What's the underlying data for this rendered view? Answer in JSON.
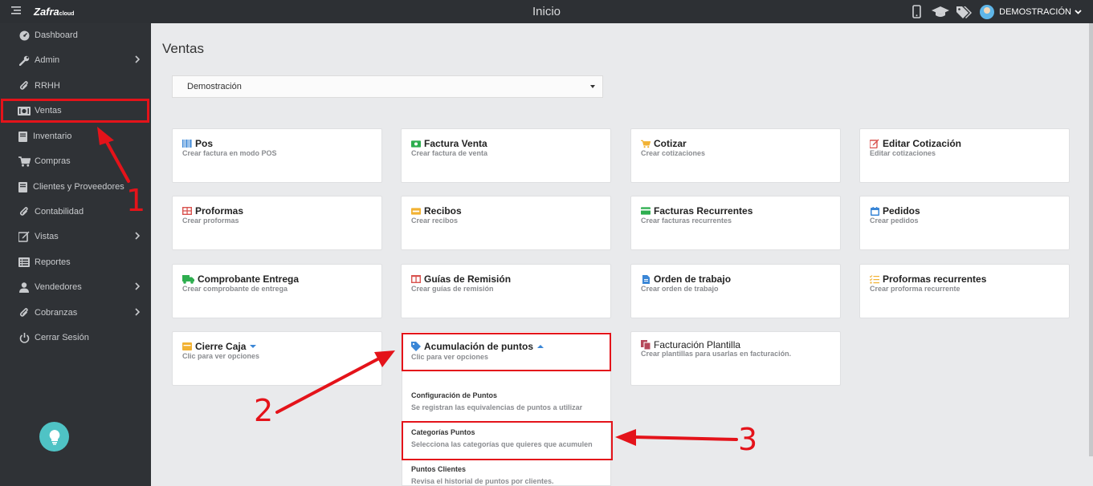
{
  "topbar": {
    "title": "Inicio",
    "logo": "Zafra",
    "logo_suffix": "cloud",
    "user_name": "DEMOSTRACIÓN",
    "icons": [
      "menu-icon",
      "mobile-icon",
      "graduation-cap-icon",
      "tags-icon",
      "avatar",
      "chevron-down-icon"
    ]
  },
  "sidebar": {
    "items": [
      {
        "label": "Dashboard",
        "icon": "dashboard-icon",
        "chevron": false
      },
      {
        "label": "Admin",
        "icon": "wrench-icon",
        "chevron": true
      },
      {
        "label": "RRHH",
        "icon": "paperclip-icon",
        "chevron": false
      },
      {
        "label": "Ventas",
        "icon": "money-icon",
        "chevron": false,
        "active": true
      },
      {
        "label": "Inventario",
        "icon": "book-icon",
        "chevron": false
      },
      {
        "label": "Compras",
        "icon": "cart-icon",
        "chevron": false
      },
      {
        "label": "Clientes y Proveedores",
        "icon": "address-book-icon",
        "chevron": false
      },
      {
        "label": "Contabilidad",
        "icon": "paperclip-icon",
        "chevron": false
      },
      {
        "label": "Vistas",
        "icon": "edit-icon",
        "chevron": true
      },
      {
        "label": "Reportes",
        "icon": "list-icon",
        "chevron": false
      },
      {
        "label": "Vendedores",
        "icon": "user-icon",
        "chevron": true
      },
      {
        "label": "Cobranzas",
        "icon": "paperclip-icon",
        "chevron": true
      },
      {
        "label": "Cerrar Sesión",
        "icon": "power-icon",
        "chevron": false
      }
    ]
  },
  "main": {
    "page_title": "Ventas",
    "company_select": "Demostración",
    "cards": [
      {
        "title": "Pos",
        "subtitle": "Crear factura en modo POS",
        "icon": "barcode-icon",
        "color": "#3a86d6"
      },
      {
        "title": "Factura Venta",
        "subtitle": "Crear factura de venta",
        "icon": "money-icon",
        "color": "#2eae4f"
      },
      {
        "title": "Cotizar",
        "subtitle": "Crear cotizaciones",
        "icon": "cart-icon",
        "color": "#f2b233"
      },
      {
        "title": "Editar Cotización",
        "subtitle": "Editar cotizaciones",
        "icon": "edit-icon",
        "color": "#d9534f"
      },
      {
        "title": "Proformas",
        "subtitle": "Crear proformas",
        "icon": "table-icon",
        "color": "#d9534f"
      },
      {
        "title": "Recibos",
        "subtitle": "Crear recibos",
        "icon": "receipt-icon",
        "color": "#f2b233"
      },
      {
        "title": "Facturas Recurrentes",
        "subtitle": "Crear facturas recurrentes",
        "icon": "credit-card-icon",
        "color": "#2eae4f"
      },
      {
        "title": "Pedidos",
        "subtitle": "Crear pedidos",
        "icon": "calendar-icon",
        "color": "#3a86d6"
      },
      {
        "title": "Comprobante Entrega",
        "subtitle": "Crear comprobante de entrega",
        "icon": "truck-icon",
        "color": "#2eae4f"
      },
      {
        "title": "Guías de Remisión",
        "subtitle": "Crear guías de remisión",
        "icon": "columns-icon",
        "color": "#d9534f"
      },
      {
        "title": "Orden de trabajo",
        "subtitle": "Crear orden de trabajo",
        "icon": "file-icon",
        "color": "#3a86d6"
      },
      {
        "title": "Proformas recurrentes",
        "subtitle": "Crear proforma recurrente",
        "icon": "tasks-icon",
        "color": "#f2b233"
      },
      {
        "title": "Cierre Caja",
        "subtitle": "Clic para ver opciones",
        "icon": "cash-box-icon",
        "color": "#f2b233",
        "caret": "down"
      },
      {
        "title": "Acumulación de puntos",
        "subtitle": "Clic para ver opciones",
        "icon": "tag-icon",
        "color": "#3a86d6",
        "caret": "up"
      },
      {
        "title": "Facturación Plantilla",
        "subtitle": "Crear plantillas para usarlas en facturación.",
        "icon": "copy-icon",
        "color": "#b5485a"
      }
    ],
    "dropdown": [
      {
        "title": "Configuración de Puntos",
        "subtitle": "Se registran las equivalencias de puntos a utilizar"
      },
      {
        "title": "Categorías Puntos",
        "subtitle": "Selecciona las categorías que quieres que acumulen"
      },
      {
        "title": "Puntos Clientes",
        "subtitle": "Revisa el historial de puntos por clientes."
      }
    ]
  },
  "annotations": {
    "step1": "1",
    "step2": "2",
    "step3": "3",
    "color": "#e4131a"
  }
}
